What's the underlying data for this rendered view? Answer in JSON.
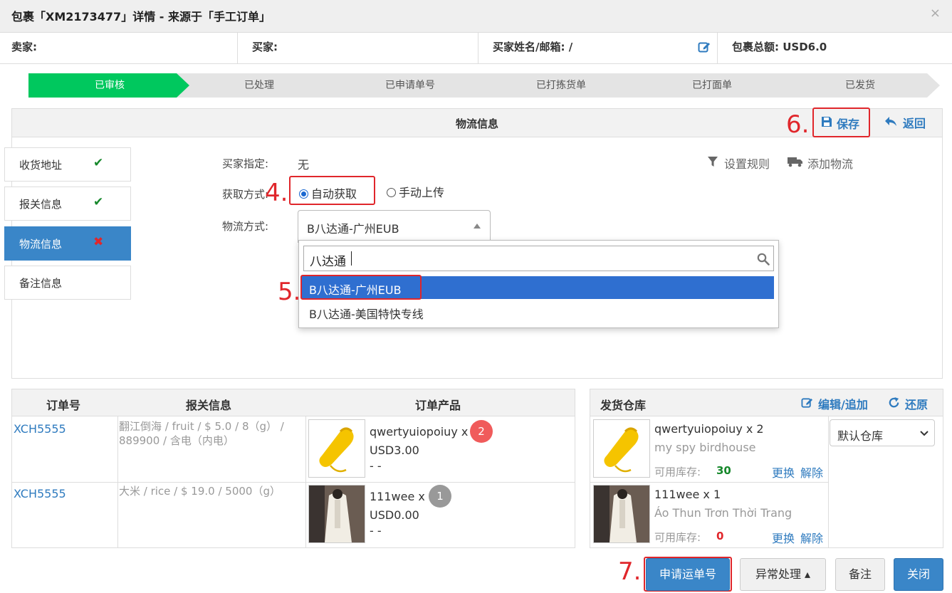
{
  "modal": {
    "title": "包裹「XM2173477」详情 - 来源于「手工订单」",
    "close_icon": "×"
  },
  "info": {
    "seller": "卖家:",
    "buyer": "买家:",
    "buyer_name_email": "买家姓名/邮箱: /",
    "total": "包裹总额: USD6.0"
  },
  "steps": [
    "已审核",
    "已处理",
    "已申请单号",
    "已打拣货单",
    "已打面单",
    "已发货"
  ],
  "logistics": {
    "title": "物流信息",
    "save_label": "保存",
    "back_label": "返回",
    "sidenav": [
      {
        "label": "收货地址",
        "mark": "✔",
        "status": "ok"
      },
      {
        "label": "报关信息",
        "mark": "✔",
        "status": "ok"
      },
      {
        "label": "物流信息",
        "mark": "✖",
        "status": "bad"
      },
      {
        "label": "备注信息",
        "mark": "",
        "status": ""
      }
    ],
    "buyer_specified_label": "买家指定:",
    "buyer_specified_value": "无",
    "set_rules": "设置规则",
    "add_logistics": "添加物流",
    "method_label": "获取方式:",
    "auto_label": "自动获取",
    "manual_label": "手动上传",
    "shipping_label": "物流方式:",
    "selected_method": "B八达通-广州EUB",
    "search_value": "八达通",
    "options": [
      "B八达通-广州EUB",
      "B八达通-美国特快专线"
    ]
  },
  "annotations": {
    "n4": "4.",
    "n5": "5.",
    "n6": "6.",
    "n7": "7."
  },
  "orders": {
    "headers": [
      "订单号",
      "报关信息",
      "订单产品"
    ],
    "rows": [
      {
        "order_no": "XCH5555",
        "customs": "翻江倒海 / fruit / $ 5.0 / 8（g） / 889900 / 含电（内电）",
        "product": "qwertyuiopoiuy x",
        "count": "2",
        "price": "USD3.00",
        "extra": "- -"
      },
      {
        "order_no": "XCH5555",
        "customs": "大米 / rice / $ 19.0 / 5000（g）",
        "product": "111wee x",
        "count": "1",
        "price": "USD0.00",
        "extra": "- -"
      }
    ]
  },
  "warehouse": {
    "title": "发货仓库",
    "edit_label": "编辑/追加",
    "restore_label": "还原",
    "select_value": "默认仓库",
    "items": [
      {
        "name": "qwertyuiopoiuy x 2",
        "sub": "my spy birdhouse",
        "stock_label": "可用库存:",
        "stock": "30",
        "replace": "更换",
        "remove": "解除"
      },
      {
        "name": "111wee x 1",
        "sub": "Áo Thun Trơn Thời Trang",
        "stock_label": "可用库存:",
        "stock": "0",
        "replace": "更换",
        "remove": "解除"
      }
    ]
  },
  "footer": {
    "apply_label": "申请运单号",
    "exception_label": "异常处理 ▴",
    "note_label": "备注",
    "close_label": "关闭"
  },
  "colors": {
    "accent": "#3a86c8",
    "step_active": "#00c85e",
    "annotation_red": "#e0262b",
    "ok_green": "#16882b"
  }
}
